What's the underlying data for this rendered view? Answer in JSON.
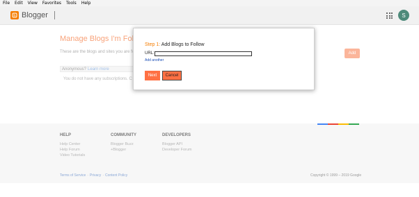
{
  "menubar": {
    "items": [
      "File",
      "Edit",
      "View",
      "Favorites",
      "Tools",
      "Help"
    ]
  },
  "header": {
    "brand": "Blogger",
    "avatar_letter": "S",
    "brand_color": "#f57d00"
  },
  "main": {
    "title": "Manage Blogs I'm Following",
    "description": "These are the blogs and sites you are fo",
    "add_label": "Add",
    "anon_prefix": "Anonymous?",
    "anon_link": "Learn more",
    "no_subs": "You do not have any subscriptions. C"
  },
  "modal": {
    "step_label": "Step 1:",
    "title": "Add Blogs to Follow",
    "url_label": "URL:",
    "url_value": "",
    "add_another": "Add another",
    "next_label": "Next",
    "cancel_label": "Cancel"
  },
  "footer": {
    "columns": [
      {
        "heading": "HELP",
        "links": [
          "Help Center",
          "Help Forum",
          "Video Tutorials"
        ]
      },
      {
        "heading": "COMMUNITY",
        "links": [
          "Blogger Buzz",
          "+Blogger"
        ]
      },
      {
        "heading": "DEVELOPERS",
        "links": [
          "Blogger API",
          "Developer Forum"
        ]
      }
    ],
    "bottom_links": [
      "Terms of Service",
      "Privacy",
      "Content Policy"
    ],
    "copyright": "Copyright © 1999 – 2019 Google",
    "color_bar": [
      "#4285f4",
      "#ea4335",
      "#fbbc05",
      "#34a853"
    ]
  }
}
